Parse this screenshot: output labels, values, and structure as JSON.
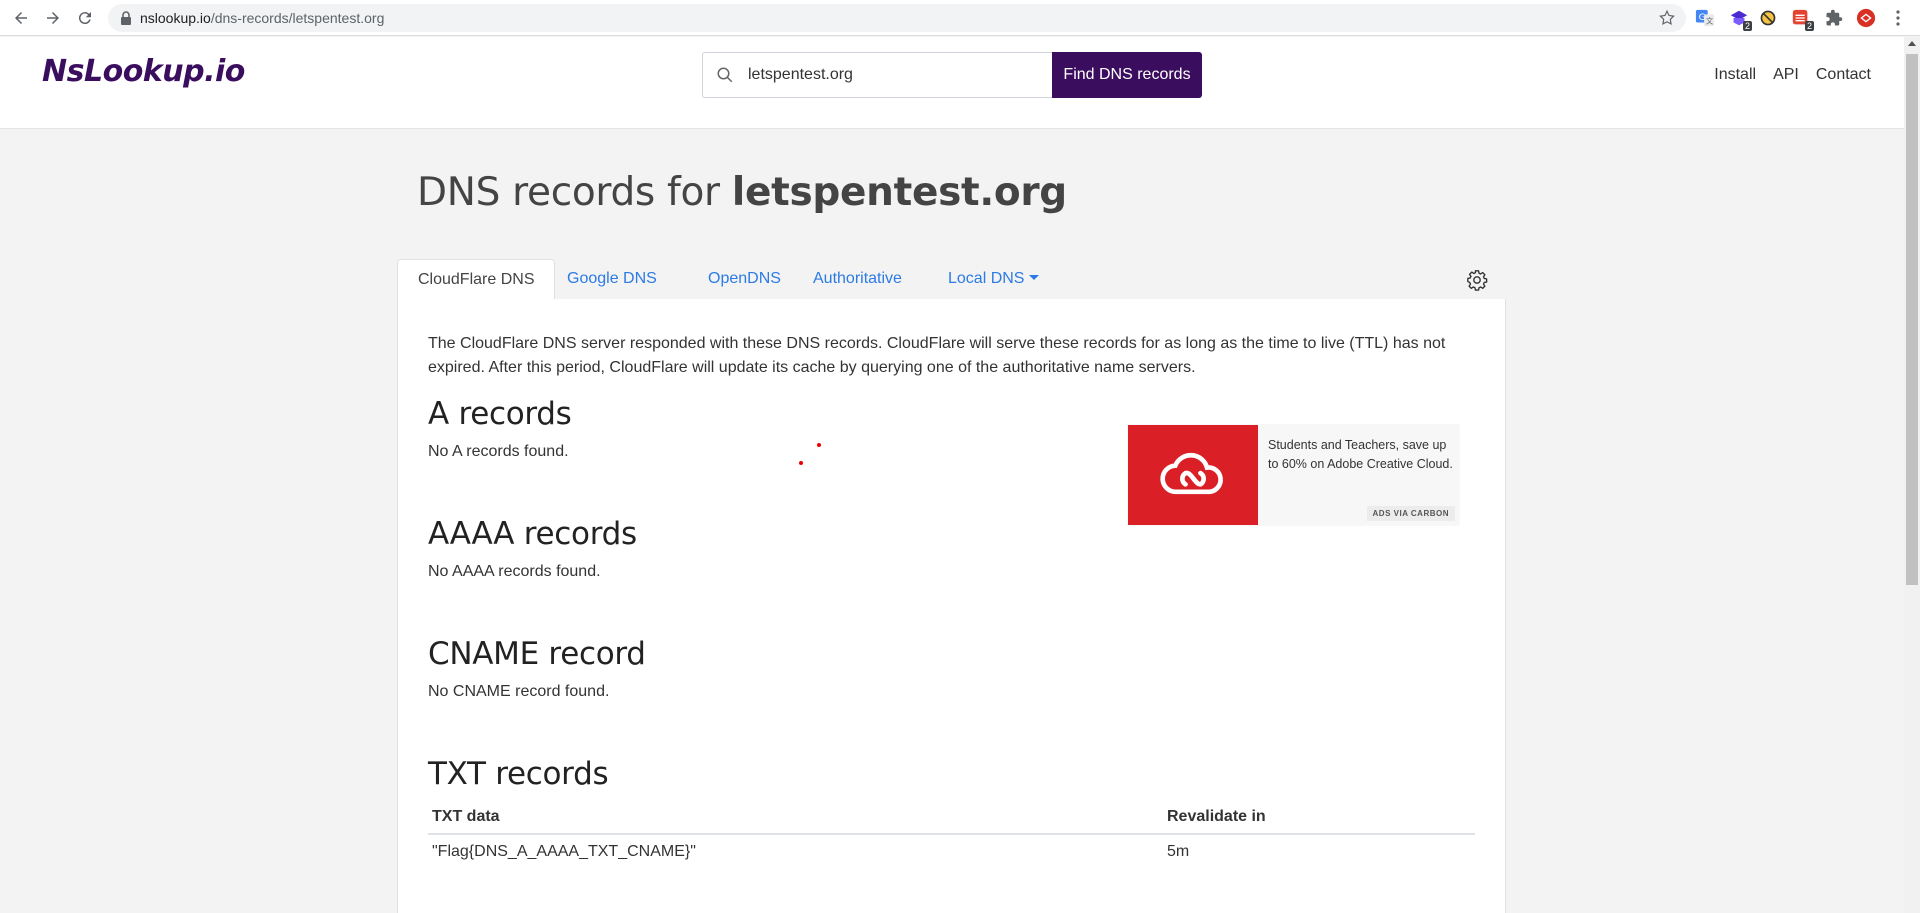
{
  "browser": {
    "url_host": "nslookup.io",
    "url_path": "/dns-records/letspentest.org",
    "extension_badges": [
      "2",
      "2"
    ]
  },
  "header": {
    "logo": "NsLookup.io",
    "search_value": "letspentest.org",
    "search_button": "Find DNS records",
    "links": [
      "Install",
      "API",
      "Contact"
    ]
  },
  "page": {
    "title_prefix": "DNS records for",
    "domain": "letspentest.org"
  },
  "tabs": [
    {
      "label": "CloudFlare DNS",
      "active": true
    },
    {
      "label": "Google DNS"
    },
    {
      "label": "OpenDNS"
    },
    {
      "label": "Authoritative"
    },
    {
      "label": "Local DNS"
    }
  ],
  "panel": {
    "intro": "The CloudFlare DNS server responded with these DNS records. CloudFlare will serve these records for as long as the time to live (TTL) has not expired. After this period, CloudFlare will update its cache by querying one of the authoritative name servers.",
    "sections": [
      {
        "heading": "A records",
        "message": "No A records found."
      },
      {
        "heading": "AAAA records",
        "message": "No AAAA records found."
      },
      {
        "heading": "CNAME record",
        "message": "No CNAME record found."
      },
      {
        "heading": "TXT records"
      }
    ],
    "txt_table": {
      "headers": [
        "TXT data",
        "Revalidate in"
      ],
      "rows": [
        [
          "\"Flag{DNS_A_AAAA_TXT_CNAME}\"",
          "5m"
        ]
      ]
    }
  },
  "ad": {
    "text": "Students and Teachers, save up to 60% on Adobe Creative Cloud.",
    "via": "ADS VIA CARBON"
  },
  "colors": {
    "brand": "#3a0d5e",
    "link": "#2c7be5",
    "ad_red": "#da1f26"
  }
}
